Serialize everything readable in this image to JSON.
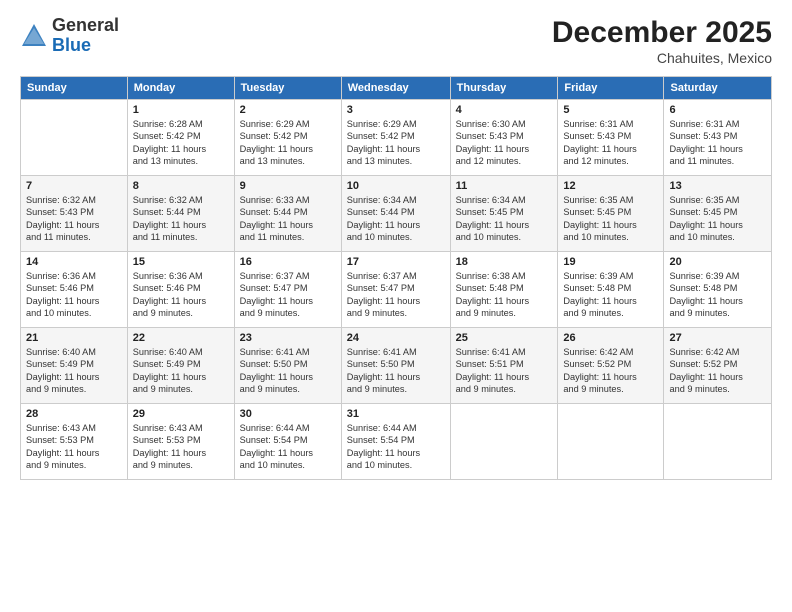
{
  "header": {
    "logo_general": "General",
    "logo_blue": "Blue",
    "month": "December 2025",
    "location": "Chahuites, Mexico"
  },
  "days_of_week": [
    "Sunday",
    "Monday",
    "Tuesday",
    "Wednesday",
    "Thursday",
    "Friday",
    "Saturday"
  ],
  "weeks": [
    [
      {
        "day": "",
        "info": ""
      },
      {
        "day": "1",
        "info": "Sunrise: 6:28 AM\nSunset: 5:42 PM\nDaylight: 11 hours\nand 13 minutes."
      },
      {
        "day": "2",
        "info": "Sunrise: 6:29 AM\nSunset: 5:42 PM\nDaylight: 11 hours\nand 13 minutes."
      },
      {
        "day": "3",
        "info": "Sunrise: 6:29 AM\nSunset: 5:42 PM\nDaylight: 11 hours\nand 13 minutes."
      },
      {
        "day": "4",
        "info": "Sunrise: 6:30 AM\nSunset: 5:43 PM\nDaylight: 11 hours\nand 12 minutes."
      },
      {
        "day": "5",
        "info": "Sunrise: 6:31 AM\nSunset: 5:43 PM\nDaylight: 11 hours\nand 12 minutes."
      },
      {
        "day": "6",
        "info": "Sunrise: 6:31 AM\nSunset: 5:43 PM\nDaylight: 11 hours\nand 11 minutes."
      }
    ],
    [
      {
        "day": "7",
        "info": "Sunrise: 6:32 AM\nSunset: 5:43 PM\nDaylight: 11 hours\nand 11 minutes."
      },
      {
        "day": "8",
        "info": "Sunrise: 6:32 AM\nSunset: 5:44 PM\nDaylight: 11 hours\nand 11 minutes."
      },
      {
        "day": "9",
        "info": "Sunrise: 6:33 AM\nSunset: 5:44 PM\nDaylight: 11 hours\nand 11 minutes."
      },
      {
        "day": "10",
        "info": "Sunrise: 6:34 AM\nSunset: 5:44 PM\nDaylight: 11 hours\nand 10 minutes."
      },
      {
        "day": "11",
        "info": "Sunrise: 6:34 AM\nSunset: 5:45 PM\nDaylight: 11 hours\nand 10 minutes."
      },
      {
        "day": "12",
        "info": "Sunrise: 6:35 AM\nSunset: 5:45 PM\nDaylight: 11 hours\nand 10 minutes."
      },
      {
        "day": "13",
        "info": "Sunrise: 6:35 AM\nSunset: 5:45 PM\nDaylight: 11 hours\nand 10 minutes."
      }
    ],
    [
      {
        "day": "14",
        "info": "Sunrise: 6:36 AM\nSunset: 5:46 PM\nDaylight: 11 hours\nand 10 minutes."
      },
      {
        "day": "15",
        "info": "Sunrise: 6:36 AM\nSunset: 5:46 PM\nDaylight: 11 hours\nand 9 minutes."
      },
      {
        "day": "16",
        "info": "Sunrise: 6:37 AM\nSunset: 5:47 PM\nDaylight: 11 hours\nand 9 minutes."
      },
      {
        "day": "17",
        "info": "Sunrise: 6:37 AM\nSunset: 5:47 PM\nDaylight: 11 hours\nand 9 minutes."
      },
      {
        "day": "18",
        "info": "Sunrise: 6:38 AM\nSunset: 5:48 PM\nDaylight: 11 hours\nand 9 minutes."
      },
      {
        "day": "19",
        "info": "Sunrise: 6:39 AM\nSunset: 5:48 PM\nDaylight: 11 hours\nand 9 minutes."
      },
      {
        "day": "20",
        "info": "Sunrise: 6:39 AM\nSunset: 5:48 PM\nDaylight: 11 hours\nand 9 minutes."
      }
    ],
    [
      {
        "day": "21",
        "info": "Sunrise: 6:40 AM\nSunset: 5:49 PM\nDaylight: 11 hours\nand 9 minutes."
      },
      {
        "day": "22",
        "info": "Sunrise: 6:40 AM\nSunset: 5:49 PM\nDaylight: 11 hours\nand 9 minutes."
      },
      {
        "day": "23",
        "info": "Sunrise: 6:41 AM\nSunset: 5:50 PM\nDaylight: 11 hours\nand 9 minutes."
      },
      {
        "day": "24",
        "info": "Sunrise: 6:41 AM\nSunset: 5:50 PM\nDaylight: 11 hours\nand 9 minutes."
      },
      {
        "day": "25",
        "info": "Sunrise: 6:41 AM\nSunset: 5:51 PM\nDaylight: 11 hours\nand 9 minutes."
      },
      {
        "day": "26",
        "info": "Sunrise: 6:42 AM\nSunset: 5:52 PM\nDaylight: 11 hours\nand 9 minutes."
      },
      {
        "day": "27",
        "info": "Sunrise: 6:42 AM\nSunset: 5:52 PM\nDaylight: 11 hours\nand 9 minutes."
      }
    ],
    [
      {
        "day": "28",
        "info": "Sunrise: 6:43 AM\nSunset: 5:53 PM\nDaylight: 11 hours\nand 9 minutes."
      },
      {
        "day": "29",
        "info": "Sunrise: 6:43 AM\nSunset: 5:53 PM\nDaylight: 11 hours\nand 9 minutes."
      },
      {
        "day": "30",
        "info": "Sunrise: 6:44 AM\nSunset: 5:54 PM\nDaylight: 11 hours\nand 10 minutes."
      },
      {
        "day": "31",
        "info": "Sunrise: 6:44 AM\nSunset: 5:54 PM\nDaylight: 11 hours\nand 10 minutes."
      },
      {
        "day": "",
        "info": ""
      },
      {
        "day": "",
        "info": ""
      },
      {
        "day": "",
        "info": ""
      }
    ]
  ]
}
